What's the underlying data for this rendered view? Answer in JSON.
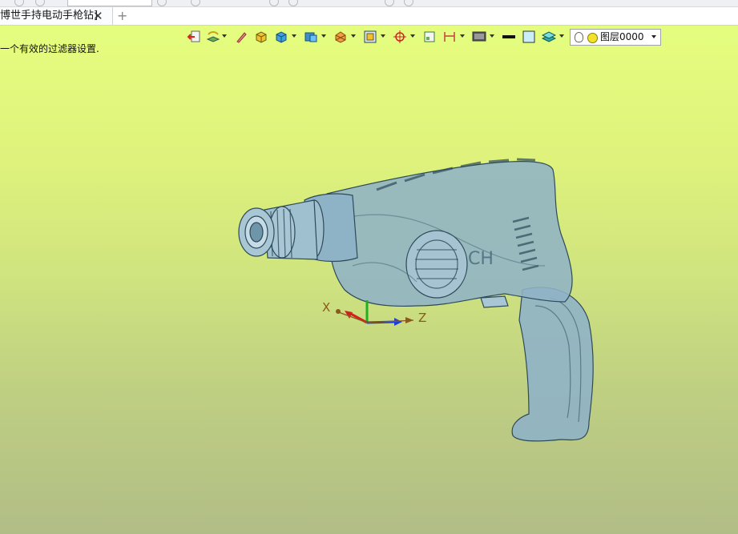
{
  "tab": {
    "title": "博世手持电动手枪钻]",
    "close_glyph": "✕",
    "add_glyph": "+"
  },
  "viewport": {
    "hint": "一个有效的过滤器设置."
  },
  "toolbar": {
    "layer_name": "图层0000",
    "icons": [
      "exit-sketch-icon",
      "mesh-display-icon",
      "pen-icon",
      "shaded-box-icon",
      "solid-box-icon",
      "view-orientation-icon",
      "section-view-icon",
      "zoom-fit-icon",
      "snap-target-icon",
      "frame-icon",
      "dimension-icon",
      "monitor-icon",
      "line-weight-icon",
      "color-swatch-icon",
      "layers-icon"
    ]
  },
  "colors": {
    "viewport_top": "#e5fd7f",
    "viewport_bottom": "#b1bd86",
    "model": "#8fb3c6",
    "axis_x": "#d42020",
    "axis_y": "#20b020",
    "axis_z": "#1f3fd8"
  },
  "axes": {
    "x_label": "X",
    "z_label": "Z"
  }
}
